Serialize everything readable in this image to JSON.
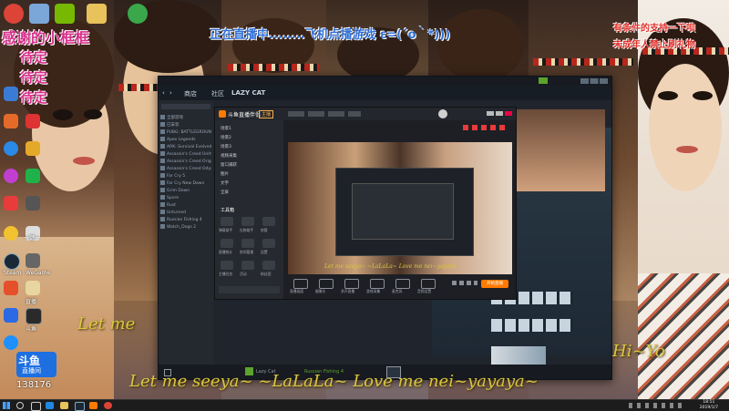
{
  "overlay": {
    "thanks_line": "感谢的小框框",
    "side_notes": [
      "待定",
      "待定",
      "待定"
    ],
    "live_status": "正在直播中........飞机点播游戏 ε=(´ο｀*)))",
    "support_line": "有条件的支持一下呗",
    "minor_notice": "未成年人禁止刷礼物",
    "lyric_small": "Let me",
    "lyric_bottom": "Let me seeya~ ~LaLaLa~ Love me nei~yayaya~",
    "lyric_right": "Hi~Yo",
    "counter_platform": "斗鱼",
    "counter_sub": "直播间",
    "counter_value": "138176"
  },
  "colors": {
    "overlay_pink": "#d62f8a",
    "overlay_blue": "#2f6fd6",
    "overlay_red": "#e0302a",
    "lyric_gold": "#d9c640",
    "steam_bg": "#1b2838",
    "client_bg": "#1d1f24",
    "taskbar": "#1c1c1c"
  },
  "desktop_icons": [
    {
      "name": "chrome-icon",
      "color": "#db4437"
    },
    {
      "name": "recycle-icon",
      "color": "#7aa6d8"
    },
    {
      "name": "nvidia-icon",
      "color": "#76b900"
    },
    {
      "name": "folder-icon",
      "color": "#e8c25a"
    },
    {
      "name": "app-icon",
      "color": "#3aa84a"
    }
  ],
  "desktop_left_labels": [
    "一键一",
    "Steam",
    "WeGame",
    "直播",
    "斗鱼"
  ],
  "steam": {
    "nav_items": [
      "商店",
      "社区",
      "LAZY CAT"
    ],
    "library_items": [
      "全部游戏",
      "已安装",
      "PUBG: BATTLEGROUND",
      "Apex Legends",
      "ARK: Survival Evolved",
      "Assassin's Creed Unity",
      "Assassin's Creed Origins",
      "Assassin's Creed Odyssey",
      "Far Cry 5",
      "Far Cry New Dawn",
      "Grim Dawn",
      "Spore",
      "Rust",
      "Unturned",
      "Russian Fishing 4",
      "Watch_Dogs 2"
    ],
    "friend_name": "Lazy Cat",
    "friend_status": "Russian Fishing 4"
  },
  "client": {
    "title": "斗鱼直播伴侣",
    "badge": "主播",
    "scene_items": [
      "场景1",
      "场景2",
      "场景3",
      "视频采集",
      "窗口捕获",
      "图片",
      "文字",
      "全屏"
    ],
    "tools_label": "工具箱",
    "tools": [
      "弹幕助手",
      "礼物助手",
      "房管",
      "直播统计",
      "房间管理",
      "设置",
      "主播任务",
      "活动",
      "粉丝团"
    ],
    "controls": [
      "直播画面",
      "摄像头",
      "多开直播",
      "游戏采集",
      "麦克风",
      "音频设置"
    ],
    "start_button": "开始直播"
  },
  "taskbar": {
    "time": "18:51",
    "date": "2019/1/7"
  }
}
